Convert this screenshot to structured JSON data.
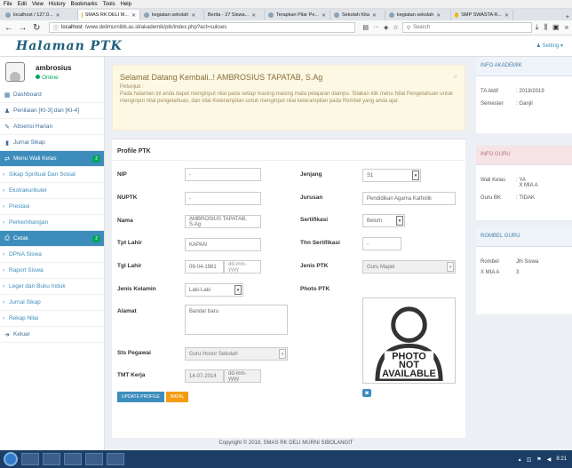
{
  "browser": {
    "menu": [
      "File",
      "Edit",
      "View",
      "History",
      "Bookmarks",
      "Tools",
      "Help"
    ],
    "tabs": [
      {
        "label": "localhost / 127.0..."
      },
      {
        "label": "SMAS RK DELI M..."
      },
      {
        "label": "kegiatan sekolah"
      },
      {
        "label": "Berita - 27 Siswa..."
      },
      {
        "label": "Terapkan Pilar Pe..."
      },
      {
        "label": "Sekolah Kita"
      },
      {
        "label": "kegiatan sekolah"
      },
      {
        "label": "SMP SWASTA R..."
      }
    ],
    "url_host": "localhost",
    "url_path": "/www.delimurnibb.ac.id/akademik/ptk/index.php?act=sukses",
    "search_placeholder": "Search"
  },
  "header": {
    "brand": "Halaman PTK",
    "setting": "Setting"
  },
  "sidebar": {
    "user_name": "ambrosius",
    "status": "Online",
    "items": [
      {
        "label": "Dashboard",
        "icon": "grid-icon"
      },
      {
        "label": "Penilaian [KI-3] dan [KI-4]",
        "icon": "user-icon"
      },
      {
        "label": "Absensi Harian",
        "icon": "pencil-icon"
      },
      {
        "label": "Jurnal Sikap",
        "icon": "book-icon"
      },
      {
        "label": "Menu Wali Kelas",
        "icon": "share-icon",
        "badge": "2"
      },
      {
        "label": "Sikap Spiritual Dan Sosial"
      },
      {
        "label": "Ekstrakurikuler"
      },
      {
        "label": "Prestasi"
      },
      {
        "label": "Perkembangan"
      },
      {
        "label": "Cetak",
        "icon": "print-icon",
        "badge": "2"
      },
      {
        "label": "DPNA Siswa"
      },
      {
        "label": "Raport Siswa"
      },
      {
        "label": "Leger dan Buku Induk"
      },
      {
        "label": "Jurnal Sikap"
      },
      {
        "label": "Rekap Nilai"
      },
      {
        "label": "Keluar",
        "icon": "logout-icon"
      }
    ]
  },
  "alert": {
    "title": "Selamat Datang Kembali..! AMBROSIUS TAPATAB, S.Ag",
    "label": "Petunjuk :",
    "text": "Pada halaman ini anda dapat menginput nilai pada setiap masing-masing mata pelajaran diampu. Silakan klik menu Nilai Pengetahuan untuk menginput nilai pengetahuan, dan nilai Keterampilan untuk menginput nilai keterampilan pada Rombel yang anda ajar."
  },
  "profile": {
    "title": "Profile PTK",
    "nip": {
      "label": "NIP",
      "value": "-"
    },
    "nuptk": {
      "label": "NUPTK",
      "value": "-"
    },
    "nama": {
      "label": "Nama",
      "value": "AMBROSIUS TAPATAB, S.Ag"
    },
    "tpt_lahir": {
      "label": "Tpt Lahir",
      "value": "KAPAN"
    },
    "tgl_lahir": {
      "label": "Tgl Lahir",
      "value": "09-04-1981",
      "hint": "dd-mm-yyyy"
    },
    "jenis_kelamin": {
      "label": "Jenis Kelamin",
      "value": "Laki-Laki"
    },
    "alamat": {
      "label": "Alamat",
      "value": "Bandar baru"
    },
    "sts_pegawai": {
      "label": "Sts Pegawai",
      "value": "Guru Honor Sekolah"
    },
    "tmt_kerja": {
      "label": "TMT Kerja",
      "value": "14-07-2014",
      "hint": "dd-mm-yyyy"
    },
    "jenjang": {
      "label": "Jenjang",
      "value": "S1"
    },
    "jurusan": {
      "label": "Jurusan",
      "value": "Pendidikan Agama Katholik"
    },
    "sertifikasi": {
      "label": "Sertifikasi",
      "value": "Belum"
    },
    "thn_sertifikasi": {
      "label": "Thn Sertifikasi",
      "value": "-"
    },
    "jenis_ptk": {
      "label": "Jenis PTK",
      "value": "Guru Mapel"
    },
    "photo": {
      "label": "Photo PTK",
      "text1": "PHOTO",
      "text2": "NOT",
      "text3": "AVAILABLE"
    },
    "update_button": "UPDATE PROFILE",
    "cancel_button": "BATAL"
  },
  "right": {
    "akademik": {
      "title": "INFO AKADEMIK",
      "ta_label": "TA Aktif",
      "ta_value": "2018/2019",
      "sem_label": "Semester",
      "sem_value": "Ganjil"
    },
    "guru": {
      "title": "INFO GURU",
      "wali_label": "Wali Kelas",
      "wali_value1": "YA",
      "wali_value2": "X MIA A",
      "bk_label": "Guru BK",
      "bk_value": "TIDAK"
    },
    "rombel": {
      "title": "ROMBEL GURU",
      "col1": "Rombel",
      "col2": "Jlh Siswa",
      "row_rombel": "X MIA A",
      "row_jlh": "3"
    }
  },
  "footer": "Copyright © 2018, SMAS RK DELI MURNI SIBOLANGIT",
  "taskbar": {
    "time": "8:21"
  },
  "colors": {
    "primary": "#3c8dbc",
    "success": "#00a65a",
    "warning_bg": "#fcf8e3",
    "cancel": "#f39c12"
  }
}
